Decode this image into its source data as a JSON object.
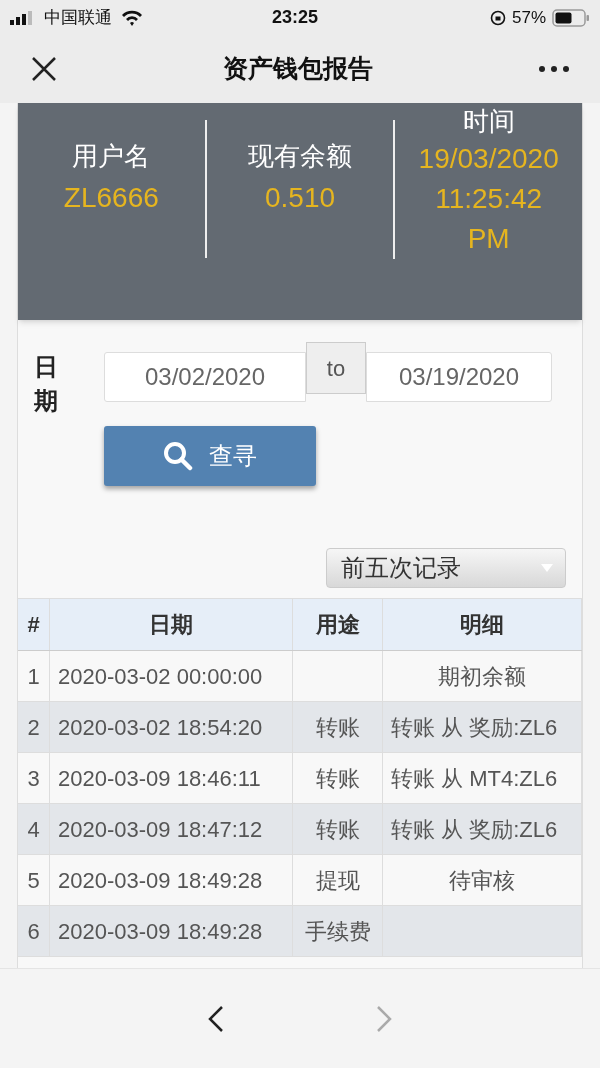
{
  "status_bar": {
    "carrier": "中国联通",
    "time": "23:25",
    "battery": "57%"
  },
  "nav_bar": {
    "title": "资产钱包报告"
  },
  "summary": [
    {
      "label": "用户名",
      "value": "ZL6666"
    },
    {
      "label": "现有余额",
      "value": "0.510"
    },
    {
      "label": "时间",
      "value": "19/03/2020 11:25:42 PM"
    }
  ],
  "filter": {
    "label": "日期",
    "from": "03/02/2020",
    "separator": "to",
    "to": "03/19/2020",
    "search_button": "查寻",
    "record_select": "前五次记录"
  },
  "table": {
    "columns": [
      "#",
      "日期",
      "用途",
      "明细"
    ],
    "rows": [
      [
        "1",
        "2020-03-02 00:00:00",
        "",
        "期初余额"
      ],
      [
        "2",
        "2020-03-02 18:54:20",
        "转账",
        "转账 从 奖励:ZL6"
      ],
      [
        "3",
        "2020-03-09 18:46:11",
        "转账",
        "转账 从 MT4:ZL6"
      ],
      [
        "4",
        "2020-03-09 18:47:12",
        "转账",
        "转账 从 奖励:ZL6"
      ],
      [
        "5",
        "2020-03-09 18:49:28",
        "提现",
        "待审核"
      ],
      [
        "6",
        "2020-03-09 18:49:28",
        "手续费",
        ""
      ]
    ]
  },
  "bottom_bar": {
    "back_disabled": false,
    "forward_disabled": true
  }
}
